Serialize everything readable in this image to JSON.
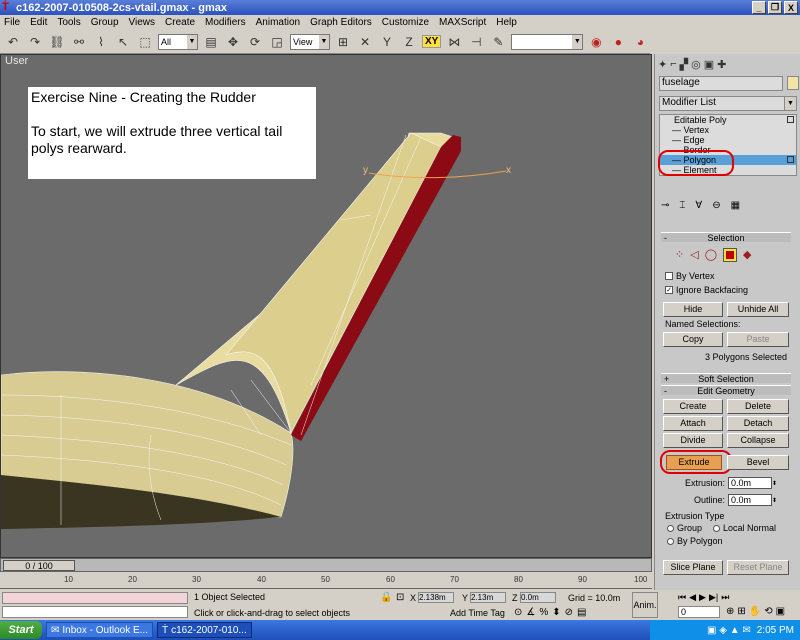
{
  "window": {
    "title": "c162-2007-010508-2cs-vtail.gmax - gmax",
    "controls": [
      "_",
      "❐",
      "X"
    ]
  },
  "menu": [
    "File",
    "Edit",
    "Tools",
    "Group",
    "Views",
    "Create",
    "Modifiers",
    "Animation",
    "Graph Editors",
    "Customize",
    "MAXScript",
    "Help"
  ],
  "toolbar": {
    "selection_filter": "All",
    "ref_coord": "View",
    "constraint_xy": "XY"
  },
  "viewport": {
    "label": "User",
    "axis_x": "x",
    "axis_y": "y",
    "note_title": "Exercise Nine - Creating the Rudder",
    "note_body": "To start, we will extrude three vertical tail polys rearward."
  },
  "command_panel": {
    "object_name": "fuselage",
    "modifier_list": "Modifier List",
    "stack_root": "Editable Poly",
    "stack_items": [
      "Vertex",
      "Edge",
      "Border",
      "Polygon",
      "Element"
    ],
    "selection_header": "Selection",
    "by_vertex": "By Vertex",
    "ignore_backfacing": "Ignore Backfacing",
    "hide": "Hide",
    "unhide_all": "Unhide All",
    "named_selections": "Named Selections:",
    "copy": "Copy",
    "paste": "Paste",
    "selected_count": "3 Polygons Selected",
    "soft_selection": "Soft Selection",
    "edit_geometry": "Edit Geometry",
    "create": "Create",
    "delete": "Delete",
    "attach": "Attach",
    "detach": "Detach",
    "divide": "Divide",
    "collapse": "Collapse",
    "extrude": "Extrude",
    "bevel": "Bevel",
    "extrusion_label": "Extrusion:",
    "extrusion_value": "0.0m",
    "outline_label": "Outline:",
    "outline_value": "0.0m",
    "extrusion_type": "Extrusion Type",
    "group": "Group",
    "local_normal": "Local Normal",
    "by_polygon": "By Polygon",
    "slice_plane": "Slice Plane",
    "reset_plane": "Reset Plane"
  },
  "timeline": {
    "slider": "0 / 100",
    "ticks": [
      "10",
      "20",
      "30",
      "40",
      "50",
      "60",
      "70",
      "80",
      "90",
      "100"
    ]
  },
  "status": {
    "selection": "1 Object Selected",
    "prompt": "Click or click-and-drag to select objects",
    "x_label": "X",
    "x_value": "2.138m",
    "y_label": "Y",
    "y_value": "2.13m",
    "z_label": "Z",
    "z_value": "0.0m",
    "grid": "Grid = 10.0m",
    "add_time_tag": "Add Time Tag",
    "anim": "Anim.",
    "frame": "0"
  },
  "taskbar": {
    "start": "Start",
    "tasks": [
      "Inbox - Outlook E...",
      "c162-2007-010..."
    ],
    "clock": "2:05 PM"
  },
  "colors": {
    "viewport_bg": "#6b6b6b",
    "tail_surface": "#e8dca0",
    "selected_polys": "#8b0a14",
    "highlight_ellipse": "#e00000",
    "stack_selection": "#5aa0d8",
    "extrude_active": "#e6a050"
  }
}
